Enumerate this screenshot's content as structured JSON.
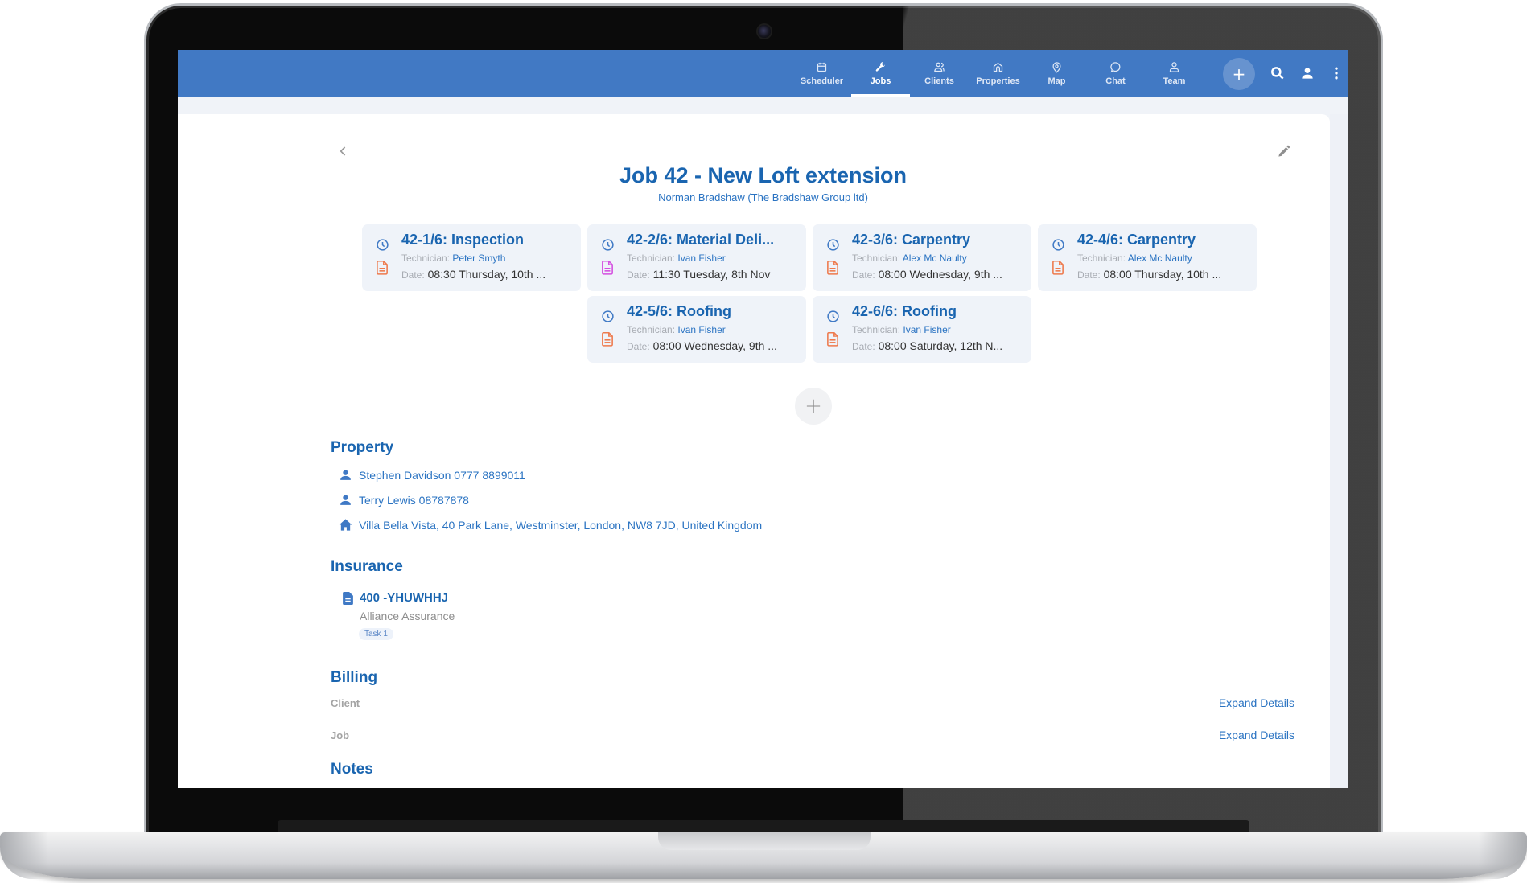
{
  "nav": {
    "items": [
      {
        "label": "Scheduler",
        "icon": "calendar-icon",
        "active": false
      },
      {
        "label": "Jobs",
        "icon": "wrench-icon",
        "active": true
      },
      {
        "label": "Clients",
        "icon": "clients-icon",
        "active": false
      },
      {
        "label": "Properties",
        "icon": "home-icon",
        "active": false
      },
      {
        "label": "Map",
        "icon": "map-pin-icon",
        "active": false
      },
      {
        "label": "Chat",
        "icon": "chat-icon",
        "active": false
      },
      {
        "label": "Team",
        "icon": "team-icon",
        "active": false
      }
    ],
    "add_label": "+",
    "actions": [
      "search-icon",
      "user-icon",
      "more-vertical-icon"
    ]
  },
  "job": {
    "title": "Job 42 - New Loft extension",
    "client": "Norman Bradshaw (The Bradshaw Group ltd)"
  },
  "labels": {
    "technician": "Technician:",
    "date": "Date:"
  },
  "tasks": [
    {
      "title": "42-1/6: Inspection",
      "technician": "Peter Smyth",
      "date": "08:30 Thursday, 10th ...",
      "doc_color": "#ee7a4d"
    },
    {
      "title": "42-2/6: Material Deli...",
      "technician": "Ivan Fisher",
      "date": "11:30 Tuesday, 8th Nov",
      "doc_color": "#d44ee0"
    },
    {
      "title": "42-3/6: Carpentry",
      "technician": "Alex Mc Naulty",
      "date": "08:00 Wednesday, 9th ...",
      "doc_color": "#ee7a4d"
    },
    {
      "title": "42-4/6: Carpentry",
      "technician": "Alex Mc Naulty",
      "date": "08:00 Thursday, 10th ...",
      "doc_color": "#ee7a4d"
    },
    {
      "title": "42-5/6: Roofing",
      "technician": "Ivan Fisher",
      "date": "08:00 Wednesday, 9th ...",
      "doc_color": "#ee7a4d"
    },
    {
      "title": "42-6/6: Roofing",
      "technician": "Ivan Fisher",
      "date": "08:00 Saturday, 12th N...",
      "doc_color": "#ee7a4d"
    }
  ],
  "add_task_label": "+",
  "property": {
    "title": "Property",
    "contacts": [
      "Stephen Davidson 0777 8899011",
      "Terry Lewis 08787878"
    ],
    "address": "Villa Bella Vista, 40 Park Lane, Westminster, London, NW8 7JD, United Kingdom"
  },
  "insurance": {
    "title": "Insurance",
    "reference": "400 -YHUWHHJ",
    "company": "Alliance Assurance",
    "tag": "Task 1"
  },
  "billing": {
    "title": "Billing",
    "rows": [
      {
        "label": "Client",
        "action": "Expand Details"
      },
      {
        "label": "Job",
        "action": "Expand Details"
      }
    ]
  },
  "notes": {
    "title": "Notes"
  },
  "colors": {
    "appbar": "#4179c4",
    "primary_text": "#1a65b0",
    "link": "#2a73c2",
    "card_bg": "#eff3f9"
  }
}
